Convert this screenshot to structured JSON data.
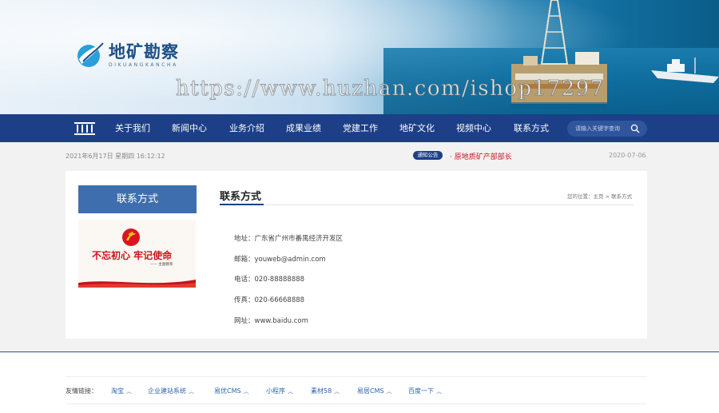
{
  "header": {
    "logo_cn": "地矿勘察",
    "logo_en": "DIKUANGKANCHA",
    "watermark": "https://www.huzhan.com/ishop17297"
  },
  "nav": {
    "items": [
      "关于我们",
      "新闻中心",
      "业务介绍",
      "成果业绩",
      "党建工作",
      "地矿文化",
      "视频中心",
      "联系方式"
    ],
    "search_placeholder": "请输入关键字查询"
  },
  "info_bar": {
    "datetime": "2021年6月17日 星期四 16:12:12",
    "notice_badge": "通知公告",
    "notice_text": "· 原地质矿产部部长",
    "notice_date": "2020-07-06"
  },
  "sidebar": {
    "title": "联系方式",
    "banner_slogan": "不忘初心 牢记使命",
    "banner_sub": "—— 主题教育"
  },
  "content": {
    "title": "联系方式",
    "breadcrumb": "您的位置：主页 > 联系方式",
    "rows": [
      "地址：广东省广州市番禺经济开发区",
      "邮箱：youweb@admin.com",
      "电话：020-88888888",
      "传真：020-66668888",
      "网址：www.baidu.com"
    ]
  },
  "footer": {
    "friend_label": "友情链接：",
    "links": [
      "淘宝",
      "企业建站系统",
      "易优CMS",
      "小程序",
      "素材58",
      "易居CMS",
      "百度一下"
    ]
  },
  "colors": {
    "nav_bg": "#1c3f87",
    "side_title_bg": "#3e6eae",
    "notice_red": "#c4181e",
    "link_blue": "#2b62b4"
  }
}
